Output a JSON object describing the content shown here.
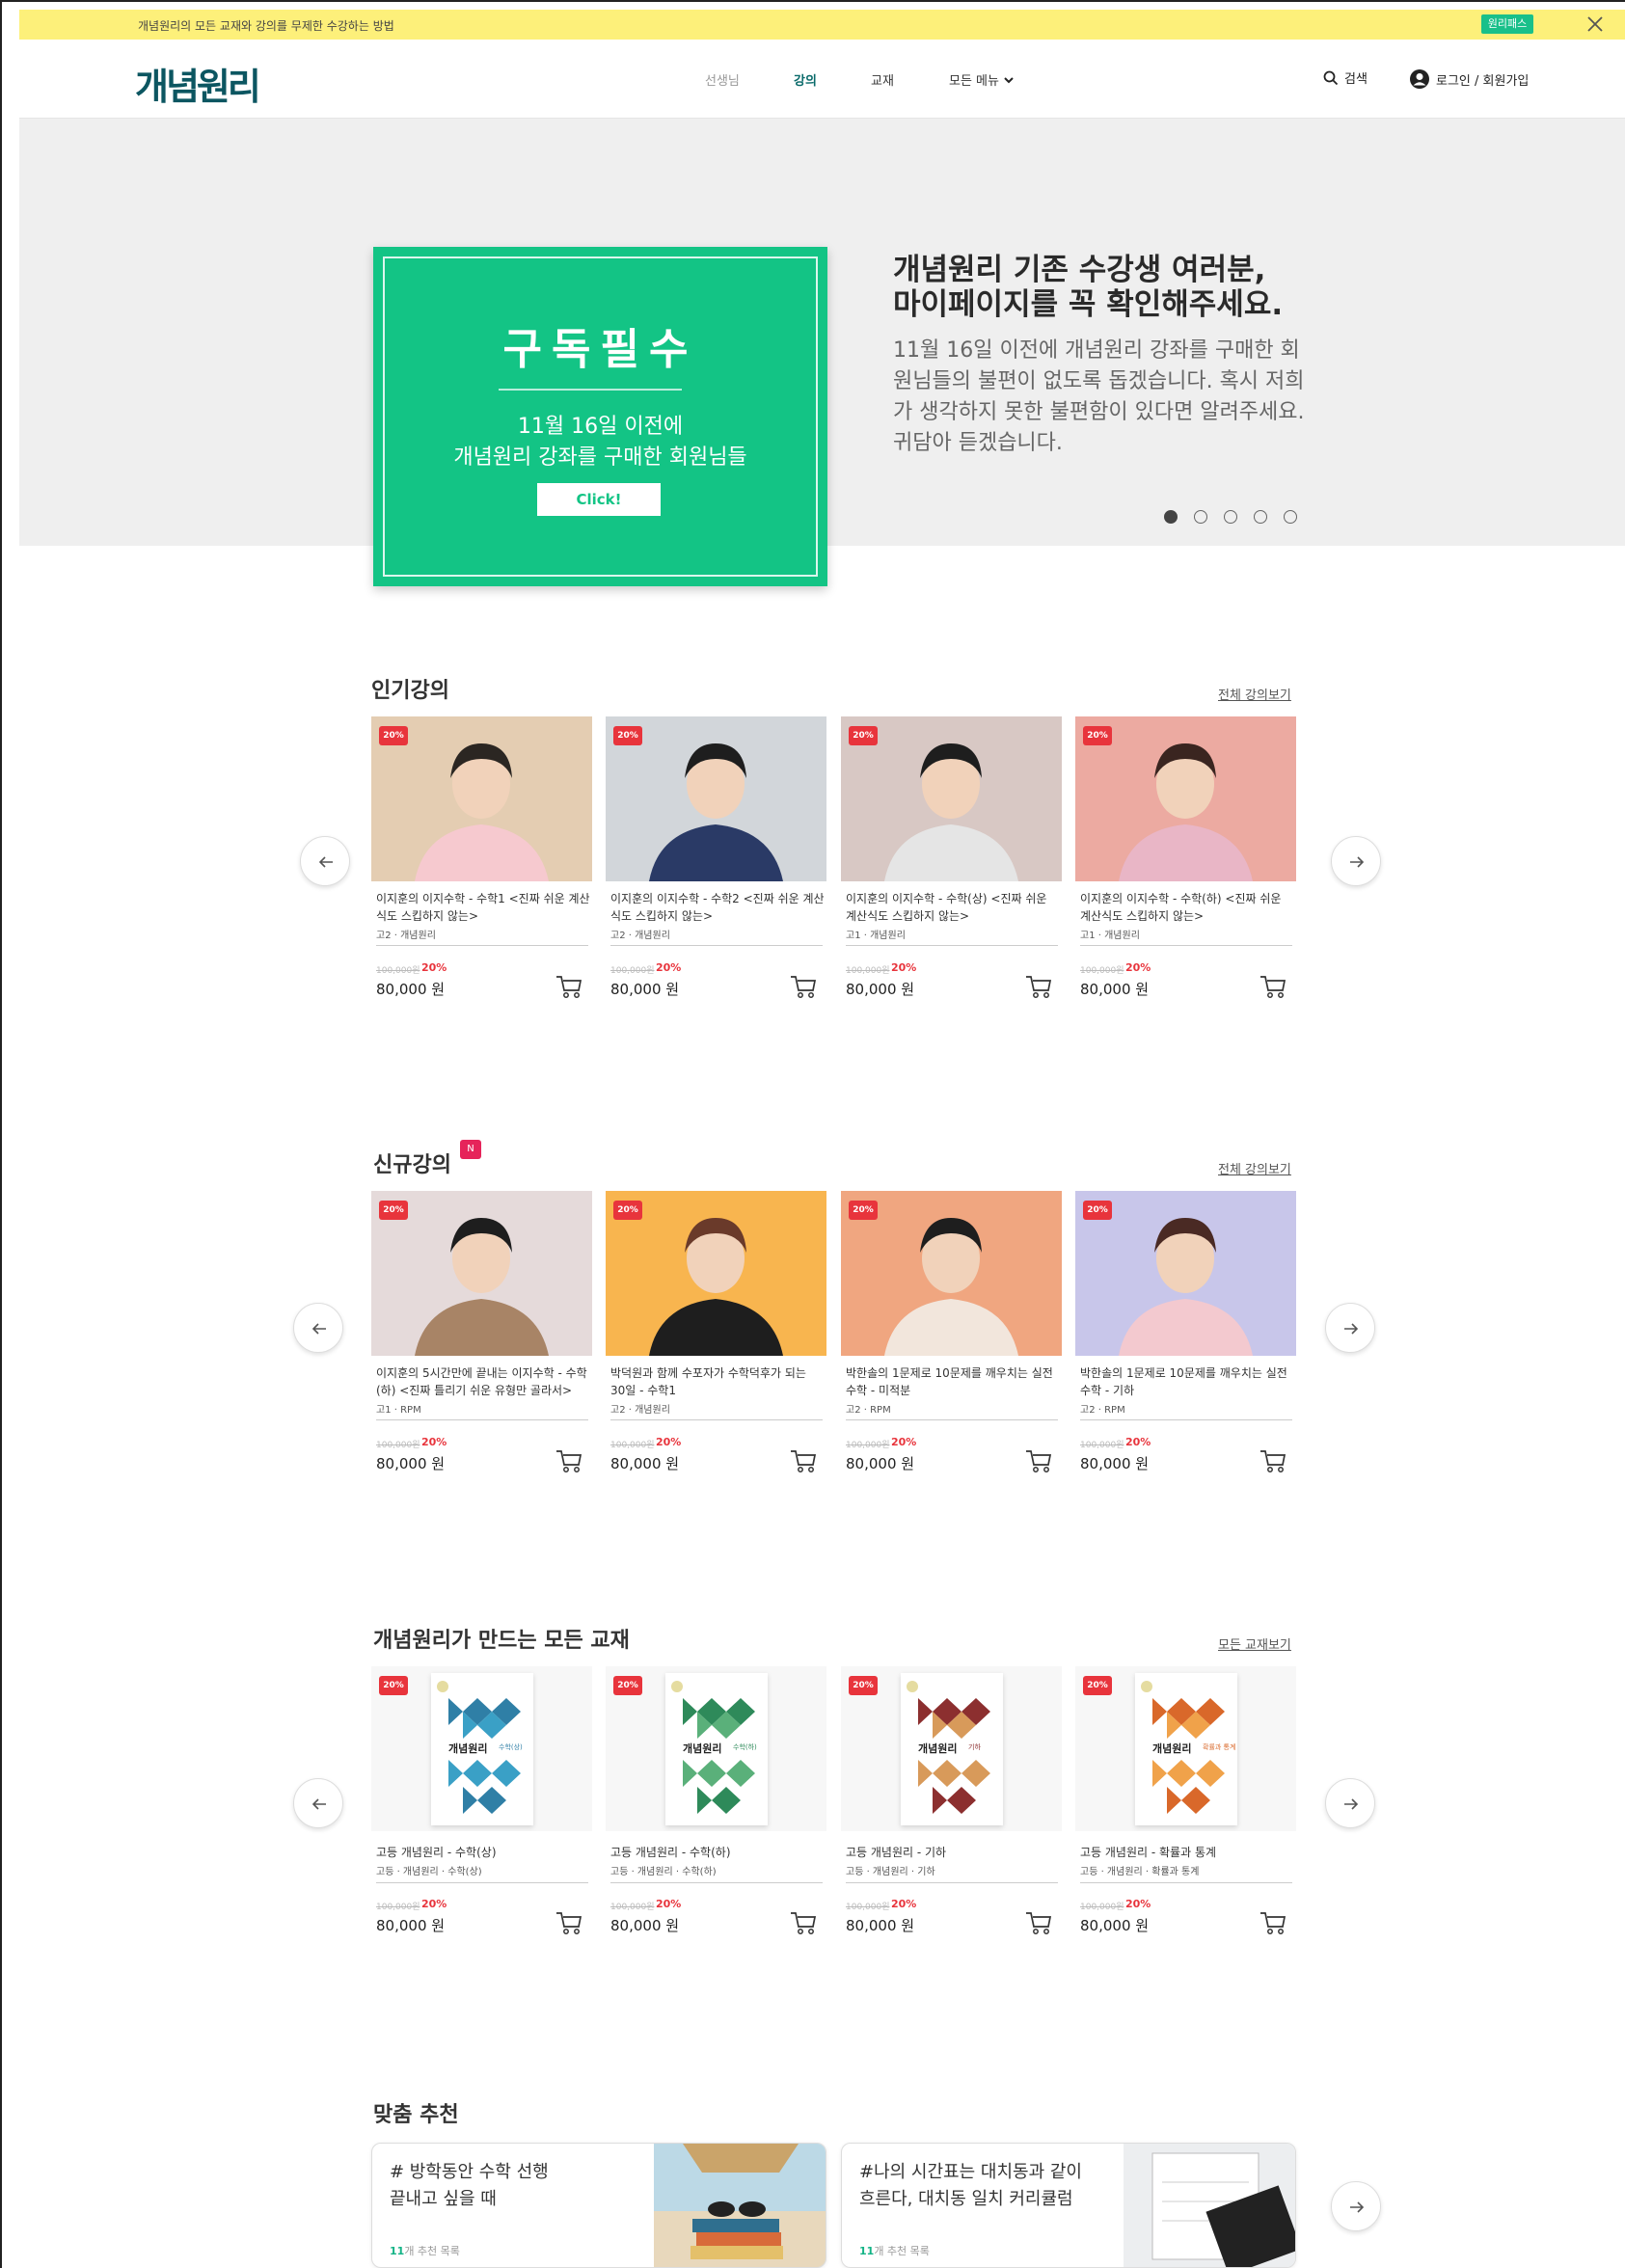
{
  "topbar": {
    "message": "개념원리의 모든 교재와 강의를 무제한 수강하는 방법",
    "pass_label": "원리패스"
  },
  "header": {
    "logo": "개념원리",
    "nav": [
      "선생님",
      "강의",
      "교재",
      "모든 메뉴"
    ],
    "search_label": "검색",
    "login_label": "로그인 / 회원가입"
  },
  "hero": {
    "promo_title": "구독필수",
    "promo_line1": "11월 16일 이전에",
    "promo_line2": "개념원리 강좌를 구매한 회원님들",
    "promo_button": "Click!",
    "heading_line1": "개념원리 기존 수강생 여러분,",
    "heading_line2": "마이페이지를 꼭 확인해주세요.",
    "body": "11월 16일 이전에 개념원리 강좌를 구매한 회원님들의 불편이 없도록 돕겠습니다. 혹시 저희가 생각하지 못한 불편함이 있다면 알려주세요. 귀담아 듣겠습니다.",
    "slide_count": 5,
    "active_slide": 1
  },
  "popular": {
    "title": "인기강의",
    "link": "전체 강의보기",
    "cards": [
      {
        "badge": "20%",
        "name": "이지훈의 이지수학 - 수학1 <진짜 쉬운 계산식도 스킵하지 않는>",
        "meta": "고2 · 개념원리",
        "orig": "100,000원",
        "pct": "20%",
        "price": "80,000 원"
      },
      {
        "badge": "20%",
        "name": "이지훈의 이지수학 - 수학2 <진짜 쉬운 계산식도 스킵하지 않는>",
        "meta": "고2 · 개념원리",
        "orig": "100,000원",
        "pct": "20%",
        "price": "80,000 원"
      },
      {
        "badge": "20%",
        "name": "이지훈의 이지수학 - 수학(상) <진짜 쉬운 계산식도 스킵하지 않는>",
        "meta": "고1 · 개념원리",
        "orig": "100,000원",
        "pct": "20%",
        "price": "80,000 원"
      },
      {
        "badge": "20%",
        "name": "이지훈의 이지수학 - 수학(하) <진짜 쉬운 계산식도 스킵하지 않는>",
        "meta": "고1 · 개념원리",
        "orig": "100,000원",
        "pct": "20%",
        "price": "80,000 원"
      }
    ]
  },
  "new_lectures": {
    "title": "신규강의",
    "new_badge": "N",
    "link": "전체 강의보기",
    "cards": [
      {
        "badge": "20%",
        "name": "이지훈의 5시간만에 끝내는 이지수학 - 수학(하) <진짜 틀리기 쉬운 유형만 골라서>",
        "meta": "고1 · RPM",
        "orig": "100,000원",
        "pct": "20%",
        "price": "80,000 원"
      },
      {
        "badge": "20%",
        "name": "박덕원과 함께 수포자가 수학덕후가 되는 30일 - 수학1",
        "meta": "고2 · 개념원리",
        "orig": "100,000원",
        "pct": "20%",
        "price": "80,000 원"
      },
      {
        "badge": "20%",
        "name": "박한솔의 1문제로 10문제를 깨우치는 실전수학 - 미적분",
        "meta": "고2 · RPM",
        "orig": "100,000원",
        "pct": "20%",
        "price": "80,000 원"
      },
      {
        "badge": "20%",
        "name": "박한솔의 1문제로 10문제를 깨우치는 실전수학 - 기하",
        "meta": "고2 · RPM",
        "orig": "100,000원",
        "pct": "20%",
        "price": "80,000 원"
      }
    ]
  },
  "books": {
    "title": "개념원리가 만드는 모든 교재",
    "link": "모든 교재보기",
    "cards": [
      {
        "badge": "20%",
        "name": "고등 개념원리 - 수학(상)",
        "meta": "고등 · 개념원리 · 수학(상)",
        "cover_sub": "수학(상)",
        "orig": "100,000원",
        "pct": "20%",
        "price": "80,000 원"
      },
      {
        "badge": "20%",
        "name": "고등 개념원리 - 수학(하)",
        "meta": "고등 · 개념원리 · 수학(하)",
        "cover_sub": "수학(하)",
        "orig": "100,000원",
        "pct": "20%",
        "price": "80,000 원"
      },
      {
        "badge": "20%",
        "name": "고등 개념원리 - 기하",
        "meta": "고등 · 개념원리 · 기하",
        "cover_sub": "기하",
        "orig": "100,000원",
        "pct": "20%",
        "price": "80,000 원"
      },
      {
        "badge": "20%",
        "name": "고등 개념원리 - 확률과 통계",
        "meta": "고등 · 개념원리 · 확률과 통계",
        "cover_sub": "확률과 통계",
        "orig": "100,000원",
        "pct": "20%",
        "price": "80,000 원"
      }
    ],
    "cover_logo": "개념원리"
  },
  "recommend": {
    "title": "맞춤 추천",
    "items": [
      {
        "line1": "# 방학동안 수학 선행",
        "line2": "끝내고 싶을 때",
        "count": "11",
        "count_suffix": "개 추천 목록"
      },
      {
        "line1": "#나의 시간표는 대치동과 같이",
        "line2": "흐른다, 대치동 일치 커리큘럼",
        "count": "11",
        "count_suffix": "개 추천 목록"
      }
    ]
  },
  "colors": {
    "brand_green": "#13c485",
    "logo_teal": "#0c5661",
    "sale_red": "#e8343c",
    "topbar_yellow": "#fdf07a"
  }
}
